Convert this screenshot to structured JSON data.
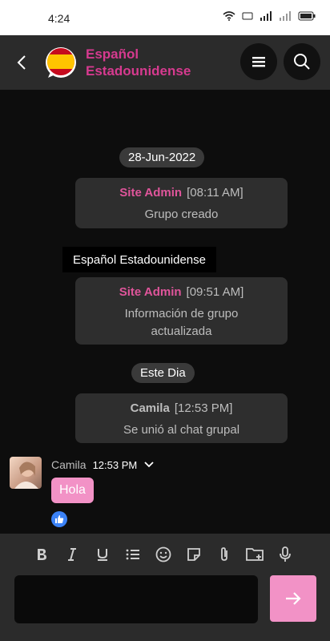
{
  "status": {
    "time": "4:24"
  },
  "header": {
    "title": "Español Estadounidense"
  },
  "chat": {
    "date_1": "28-Jun-2022",
    "system_1": {
      "name": "Site Admin",
      "time": "[08:11 AM]",
      "text": "Grupo creado"
    },
    "tooltip": "Español Estadounidense",
    "system_2": {
      "name": "Site Admin",
      "time": "[09:51 AM]",
      "text": "Información de grupo actualizada"
    },
    "date_2": "Este Dia",
    "system_3": {
      "name": "Camila",
      "time": "[12:53 PM]",
      "text": "Se unió al chat grupal"
    },
    "message": {
      "author": "Camila",
      "time": "12:53 PM",
      "text": "Hola"
    }
  },
  "composer": {
    "placeholder": ""
  },
  "colors": {
    "accent": "#f292c6",
    "title": "#d63a8f",
    "admin": "#e0559b"
  }
}
